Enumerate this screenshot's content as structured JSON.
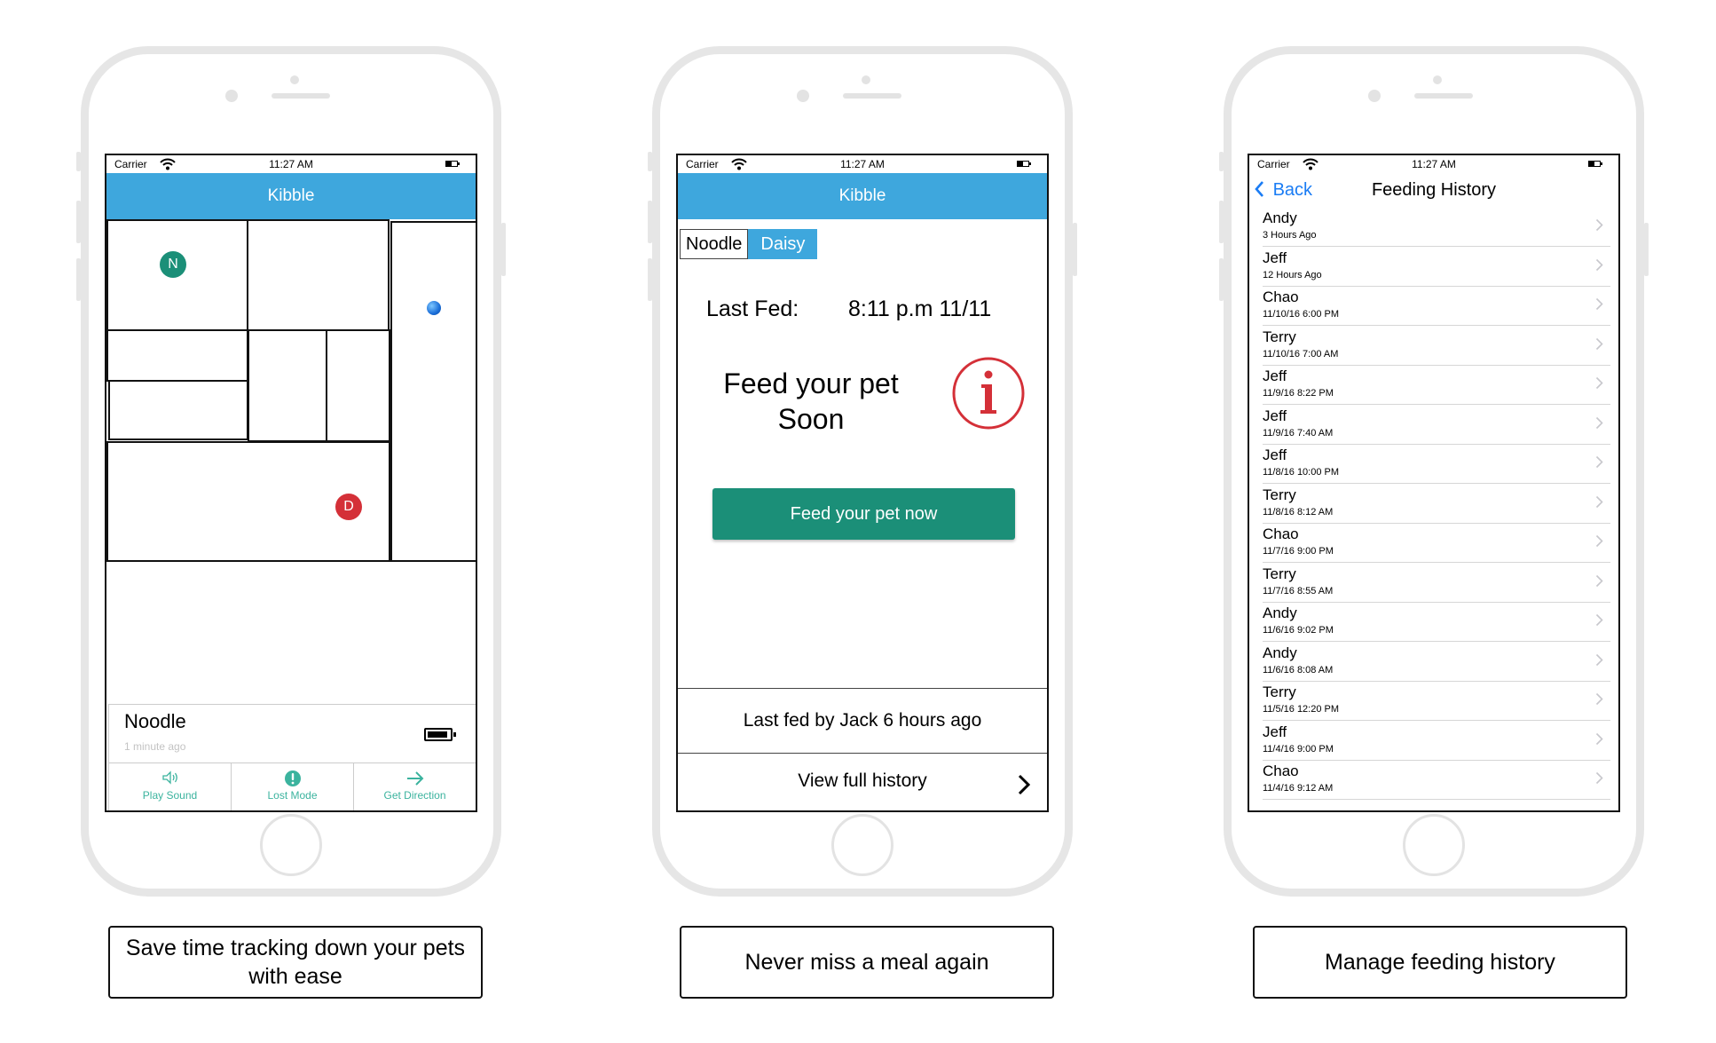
{
  "status_bar": {
    "carrier": "Carrier",
    "time": "11:27 AM"
  },
  "tracking_screen": {
    "title": "Kibble",
    "pets_on_map": [
      {
        "initial": "N",
        "color": "#1b8f78"
      },
      {
        "initial": "D",
        "color": "#d43038"
      }
    ],
    "pet_name": "Noodle",
    "last_seen": "1 minute ago",
    "actions": [
      {
        "label": "Play Sound",
        "icon": "speaker-icon"
      },
      {
        "label": "Lost Mode",
        "icon": "alert-icon"
      },
      {
        "label": "Get Direction",
        "icon": "arrow-right-icon"
      }
    ]
  },
  "feeding_screen": {
    "title": "Kibble",
    "tabs": [
      {
        "label": "Noodle",
        "selected": false
      },
      {
        "label": "Daisy",
        "selected": true
      }
    ],
    "last_fed_label": "Last Fed:",
    "last_fed_value": "8:11 p.m 11/11",
    "alert_line1": "Feed your pet",
    "alert_line2": "Soon",
    "alert_icon": "info-icon",
    "feed_button": "Feed your pet now",
    "last_fed_by": "Last fed by Jack 6 hours ago",
    "view_history": "View full history"
  },
  "history_screen": {
    "back_label": "Back",
    "title": "Feeding History",
    "entries": [
      {
        "name": "Andy",
        "time": "3 Hours Ago"
      },
      {
        "name": "Jeff",
        "time": "12 Hours Ago"
      },
      {
        "name": "Chao",
        "time": "11/10/16 6:00 PM"
      },
      {
        "name": "Terry",
        "time": "11/10/16 7:00 AM"
      },
      {
        "name": "Jeff",
        "time": "11/9/16 8:22 PM"
      },
      {
        "name": "Jeff",
        "time": "11/9/16 7:40 AM"
      },
      {
        "name": "Jeff",
        "time": "11/8/16 10:00 PM"
      },
      {
        "name": "Terry",
        "time": "11/8/16 8:12 AM"
      },
      {
        "name": "Chao",
        "time": "11/7/16 9:00 PM"
      },
      {
        "name": "Terry",
        "time": "11/7/16 8:55 AM"
      },
      {
        "name": "Andy",
        "time": "11/6/16 9:02 PM"
      },
      {
        "name": "Andy",
        "time": "11/6/16 8:08 AM"
      },
      {
        "name": "Terry",
        "time": "11/5/16 12:20 PM"
      },
      {
        "name": "Jeff",
        "time": "11/4/16 9:00 PM"
      },
      {
        "name": "Chao",
        "time": "11/4/16 9:12 AM"
      }
    ]
  },
  "captions": [
    "Save time tracking down your pets with ease",
    "Never miss a meal again",
    "Manage feeding history"
  ],
  "colors": {
    "nav_blue": "#3ea7dd",
    "teal": "#1b8f78",
    "alert_red": "#d43038",
    "ios_blue": "#1a7cf4"
  }
}
